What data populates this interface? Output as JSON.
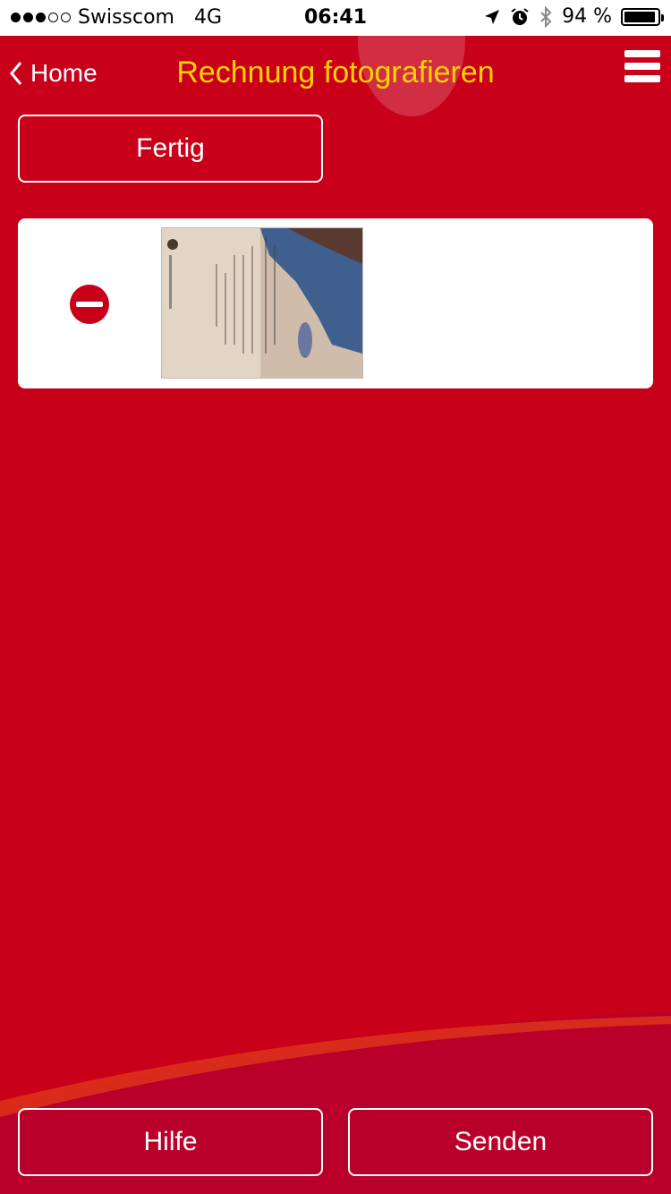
{
  "status_bar": {
    "carrier": "Swisscom",
    "network": "4G",
    "time": "06:41",
    "battery": "94 %",
    "battery_level": 0.94,
    "icons": [
      "signal-dots-icon",
      "location-arrow-icon",
      "alarm-icon",
      "bluetooth-icon",
      "battery-icon"
    ]
  },
  "header": {
    "back_label": "Home",
    "title": "Rechnung fotografieren"
  },
  "actions": {
    "done_label": "Fertig",
    "help_label": "Hilfe",
    "send_label": "Senden"
  },
  "colors": {
    "background": "#c8001a",
    "title": "#ffd200",
    "card": "#ffffff"
  }
}
